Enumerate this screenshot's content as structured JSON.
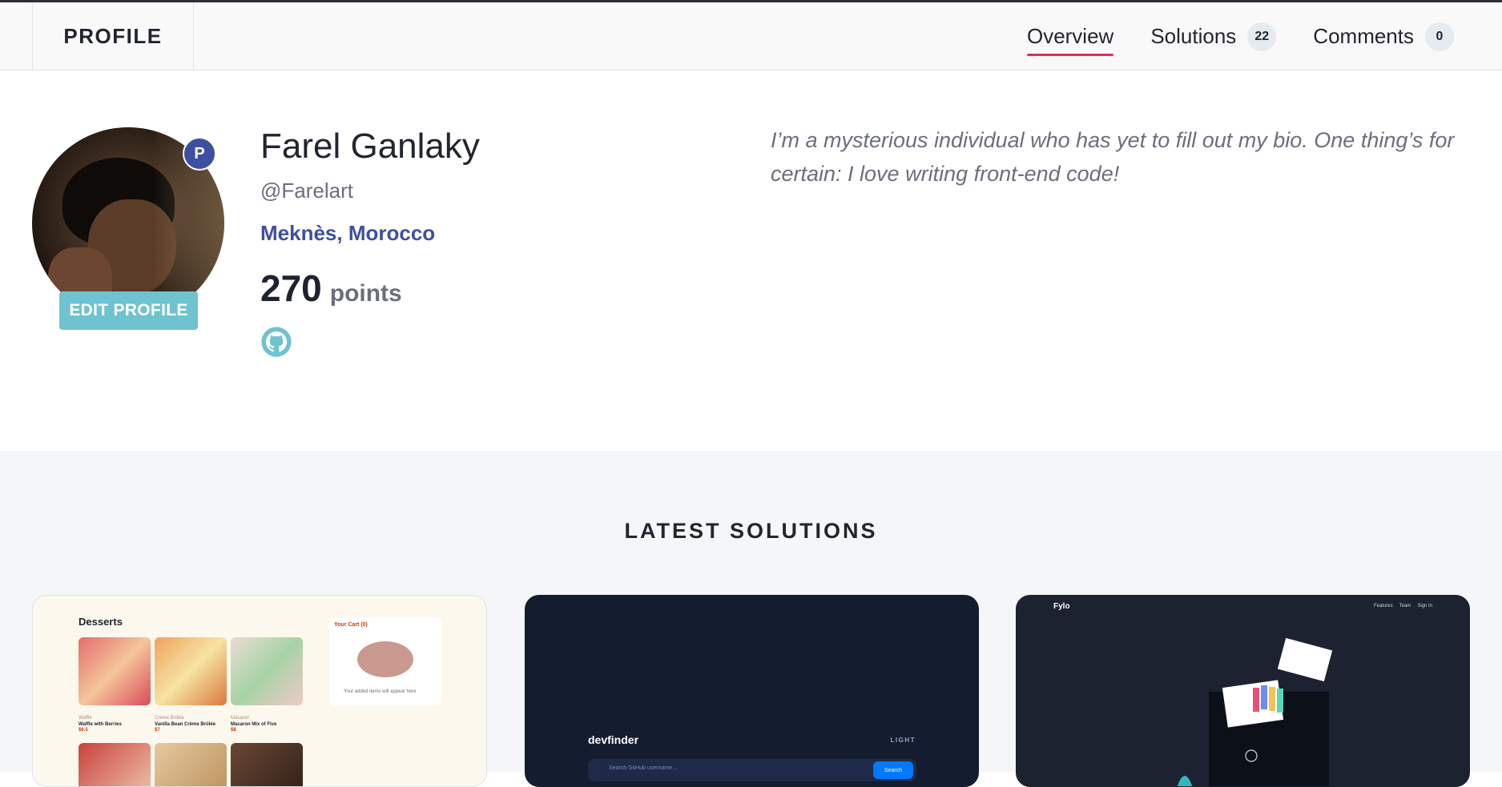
{
  "header": {
    "brand": "PROFILE",
    "tabs": [
      {
        "label": "Overview",
        "active": true
      },
      {
        "label": "Solutions",
        "count": "22"
      },
      {
        "label": "Comments",
        "count": "0"
      }
    ]
  },
  "profile": {
    "premium_badge": "P",
    "edit_button": "EDIT PROFILE",
    "name": "Farel Ganlaky",
    "username": "@Farelart",
    "location": "Meknès, Morocco",
    "points_value": "270",
    "points_label": "points",
    "github_icon": "github-icon",
    "bio": "I’m a mysterious individual who has yet to fill out my bio. One thing’s for certain: I love writing front-end code!"
  },
  "latest": {
    "title": "LATEST SOLUTIONS",
    "cards": [
      {
        "title": "Desserts",
        "cart_title": "Your Cart (0)",
        "cart_note": "Your added items will appear here",
        "items": [
          {
            "category": "Waffle",
            "name": "Waffle with Berries",
            "price": "$6.5"
          },
          {
            "category": "Crème Brûlée",
            "name": "Vanilla Bean Crème Brûlée",
            "price": "$7"
          },
          {
            "category": "Macaron",
            "name": "Macaron Mix of Five",
            "price": "$8"
          }
        ]
      },
      {
        "brand": "devfinder",
        "mode": "LIGHT",
        "search_placeholder": "Search GitHub username…",
        "search_button": "Search"
      },
      {
        "brand": "Fylo",
        "nav": [
          "Features",
          "Team",
          "Sign In"
        ]
      }
    ]
  },
  "colors": {
    "accent_underline": "#e12d58",
    "location_blue": "#3e4fa1",
    "edit_button": "#6dc3cf",
    "premium_badge": "#3e4fa1"
  }
}
